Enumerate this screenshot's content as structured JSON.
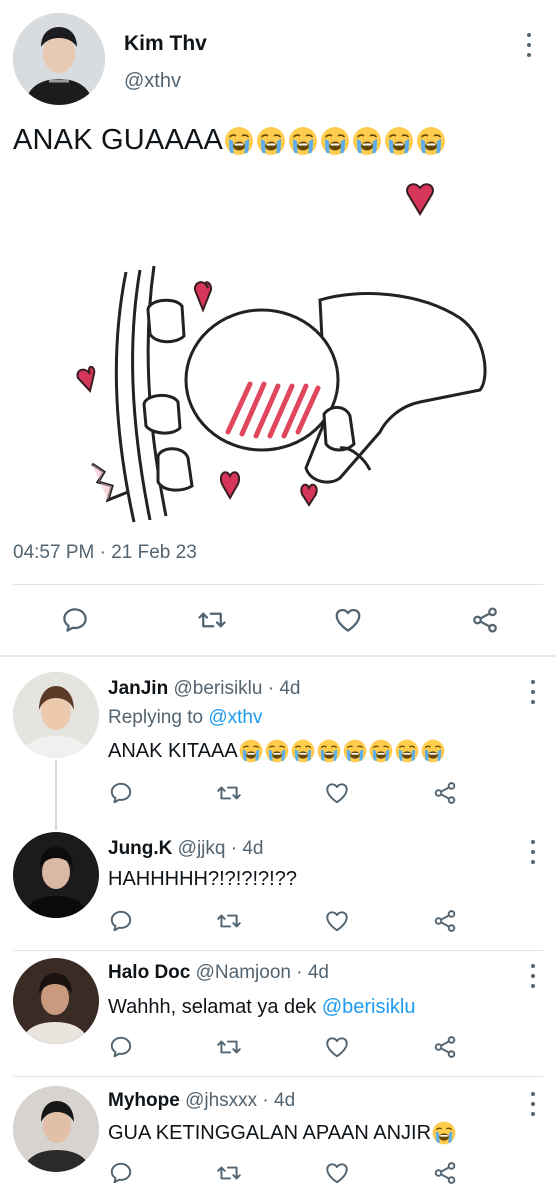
{
  "main_tweet": {
    "name": "Kim Thv",
    "handle": "@xthv",
    "text": "ANAK GUAAAA",
    "emoji_count": 7,
    "timestamp": "04:57 PM · 21 Feb 23",
    "image_desc_icon": "blushing-cartoon-sticker"
  },
  "replies": [
    {
      "name": "JanJin",
      "handle": "@berisiklu",
      "dot": "·",
      "time": "4d",
      "replying_label": "Replying to",
      "replying_to": "@xthv",
      "text": "ANAK KITAAA",
      "emoji_count": 8
    },
    {
      "name": "Jung.K",
      "handle": "@jjkq",
      "dot": "·",
      "time": "4d",
      "text": "HAHHHHH?!?!?!?!??",
      "emoji_count": 0
    },
    {
      "name": "Halo Doc",
      "handle": "@Namjoon",
      "dot": "·",
      "time": "4d",
      "text": "Wahhh, selamat ya dek",
      "mention": "@berisiklu",
      "emoji_count": 0
    },
    {
      "name": "Myhope",
      "handle": "@jhsxxx",
      "dot": "·",
      "time": "4d",
      "text": "GUA KETINGGALAN APAAN ANJIR",
      "emoji_count": 1
    }
  ],
  "icons": {
    "reply": "reply-icon",
    "retweet": "retweet-icon",
    "like": "heart-icon",
    "share": "share-icon",
    "more": "more-vertical-icon",
    "emoji": "loudly-crying-face-emoji"
  },
  "colors": {
    "text": "#0f1419",
    "secondary": "#536471",
    "link": "#1d9bf0",
    "divider": "#e1e5e8"
  }
}
